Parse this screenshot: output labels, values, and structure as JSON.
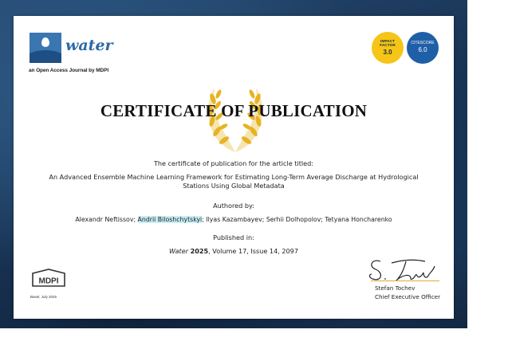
{
  "journal": {
    "name": "water",
    "tagline": "an Open Access Journal by MDPI"
  },
  "badges": {
    "impact": {
      "label": "IMPACT FACTOR",
      "value": "3.0",
      "color": "#f5c517"
    },
    "citescore": {
      "label": "CITESCORE",
      "value": "6.0",
      "color": "#1f5fa8"
    }
  },
  "certificate": {
    "title": "CERTIFICATE OF PUBLICATION",
    "intro": "The certificate of publication for the article titled:",
    "article_title": "An Advanced Ensemble Machine Learning Framework for Estimating Long-Term Average Discharge at Hydrological Stations Using Global Metadata",
    "authored_by": "Authored by:",
    "authors": {
      "before": "Alexandr Neftissov; ",
      "highlighted": "Andrii Biloshchytskyi",
      "after": "; Ilyas Kazambayev; Serhii Dolhopolov; Tetyana Honcharenko"
    },
    "published_in": "Published in:",
    "citation": {
      "journal": "Water",
      "year": "2025",
      "rest": ", Volume 17, Issue 14, 2097"
    }
  },
  "publisher": {
    "logo_text": "MDPI",
    "place_date": "Basel, July 2025"
  },
  "signatory": {
    "name": "Stefan Tochev",
    "role": "Chief Executive Officer"
  },
  "colors": {
    "laurel": "#e6b422",
    "brand_blue": "#2c6aa5",
    "highlight": "#c7eef5"
  }
}
